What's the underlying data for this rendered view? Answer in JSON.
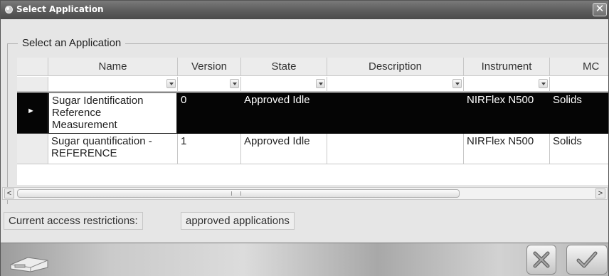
{
  "window": {
    "title": "Select Application",
    "close_glyph": "✕"
  },
  "group": {
    "label": "Select an Application"
  },
  "grid": {
    "columns": [
      "Name",
      "Version",
      "State",
      "Description",
      "Instrument",
      "MC"
    ],
    "rows": [
      {
        "name_lines": [
          "Sugar Identification",
          "Reference",
          "Measurement"
        ],
        "version": "0",
        "state": "Approved Idle",
        "description": "",
        "instrument": "NIRFlex N500",
        "mc": "Solids",
        "selected": true
      },
      {
        "name_lines": [
          "Sugar quantification -",
          "REFERENCE"
        ],
        "version": "1",
        "state": "Approved Idle",
        "description": "",
        "instrument": "NIRFlex N500",
        "mc": "Solids",
        "selected": false
      }
    ],
    "current_row_glyph": "►"
  },
  "scrollbar": {
    "left_glyph": "<",
    "right_glyph": ">"
  },
  "restrictions": {
    "label": "Current access restrictions:",
    "value": "approved applications"
  },
  "icons": {
    "title": "app-window-icon",
    "footer_logo": "instrument-logo-icon",
    "cancel": "cancel-x-icon",
    "ok": "checkmark-icon"
  }
}
